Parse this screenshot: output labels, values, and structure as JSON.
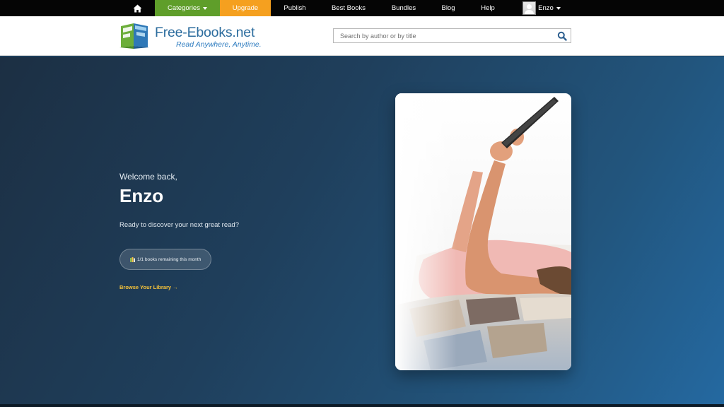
{
  "nav": {
    "home_icon": "home-icon",
    "categories_label": "Categories",
    "upgrade_label": "Upgrade",
    "publish_label": "Publish",
    "best_books_label": "Best Books",
    "bundles_label": "Bundles",
    "blog_label": "Blog",
    "help_label": "Help",
    "user_name": "Enzo"
  },
  "header": {
    "logo_text": "Free-Ebooks.net",
    "logo_tagline": "Read Anywhere, Anytime.",
    "search_placeholder": "Search by author or by title",
    "search_icon": "search-icon"
  },
  "hero": {
    "welcome": "Welcome back,",
    "name": "Enzo",
    "tagline": "Ready to discover your next great read?",
    "books_remaining": "1/1 books remaining this month",
    "browse_link": "Browse Your Library →"
  },
  "colors": {
    "nav_background": "#050505",
    "categories_bg": "#5f9e2a",
    "upgrade_bg": "#f5a01f",
    "brand_blue": "#2d6d9e",
    "link_yellow": "#f6c33a",
    "hero_dark": "#1c2f43",
    "hero_light": "#2469a1"
  }
}
